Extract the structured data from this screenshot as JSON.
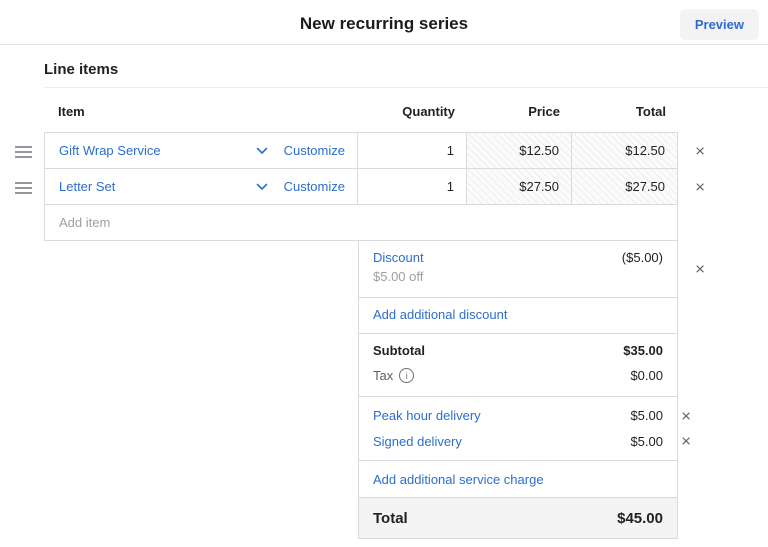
{
  "header": {
    "title": "New recurring series",
    "preview_label": "Preview"
  },
  "section": {
    "title": "Line items"
  },
  "table": {
    "columns": {
      "item": "Item",
      "quantity": "Quantity",
      "price": "Price",
      "total": "Total"
    },
    "rows": [
      {
        "item": "Gift Wrap Service",
        "customize": "Customize",
        "quantity": "1",
        "price": "$12.50",
        "total": "$12.50"
      },
      {
        "item": "Letter Set",
        "customize": "Customize",
        "quantity": "1",
        "price": "$27.50",
        "total": "$27.50"
      }
    ],
    "add_item_placeholder": "Add item"
  },
  "summary": {
    "discount": {
      "label": "Discount",
      "description": "$5.00 off",
      "amount": "($5.00)"
    },
    "add_discount_label": "Add additional discount",
    "subtotal": {
      "label": "Subtotal",
      "amount": "$35.00"
    },
    "tax": {
      "label": "Tax",
      "amount": "$0.00"
    },
    "service_charges": [
      {
        "label": "Peak hour delivery",
        "amount": "$5.00"
      },
      {
        "label": "Signed delivery",
        "amount": "$5.00"
      }
    ],
    "add_service_charge_label": "Add additional service charge",
    "total": {
      "label": "Total",
      "amount": "$45.00"
    }
  },
  "icons": {
    "close": "×",
    "info": "i"
  },
  "colors": {
    "link_blue": "#2c6ecb",
    "text": "#202223",
    "muted": "#9a9fa5",
    "border": "#d8dadd",
    "total_row_bg": "#f4f4f4",
    "preview_button_bg": "#f3f3f5"
  }
}
